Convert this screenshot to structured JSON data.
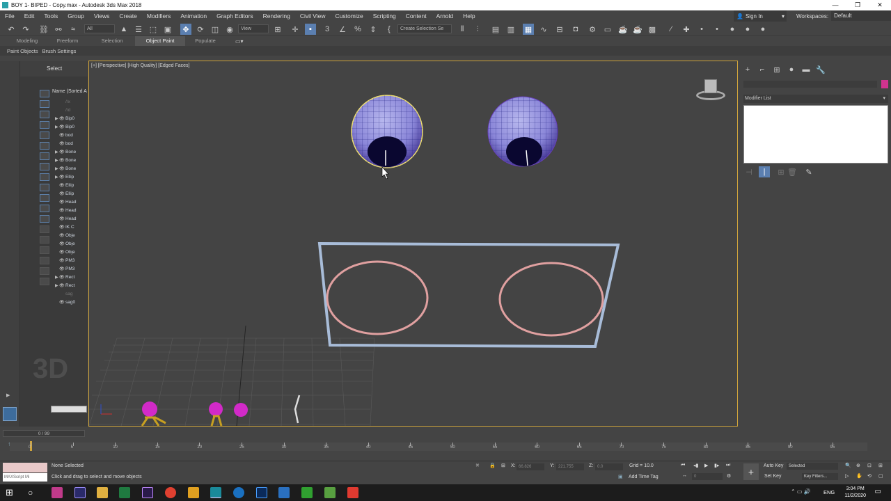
{
  "window": {
    "title": "BOY 1- BIPED - Copy.max - Autodesk 3ds Max 2018",
    "minimize": "—",
    "maximize": "❐",
    "close": "✕"
  },
  "menu": [
    "File",
    "Edit",
    "Tools",
    "Group",
    "Views",
    "Create",
    "Modifiers",
    "Animation",
    "Graph Editors",
    "Rendering",
    "Civil View",
    "Customize",
    "Scripting",
    "Content",
    "Arnold",
    "Help"
  ],
  "signin": "Sign In",
  "workspace": {
    "label": "Workspaces:",
    "value": "Default"
  },
  "toolbar": {
    "filter": "All",
    "refcoord": "View",
    "selection_set": "Create Selection Se"
  },
  "ribbon": {
    "tabs": [
      "Modeling",
      "Freeform",
      "Selection",
      "Object Paint",
      "Populate"
    ],
    "active": "Object Paint",
    "sub": [
      "Paint Objects",
      "Brush Settings"
    ]
  },
  "scene_explorer": {
    "header": "Select",
    "column": "Name (Sorted A",
    "rows": [
      "//x",
      "//d",
      "Bip0",
      "Bip0",
      "bod",
      "bod",
      "Bone",
      "Bone",
      "Bone",
      "Ellip",
      "Ellip",
      "Ellip",
      "Head",
      "Head",
      "Head",
      "IK C",
      "Obje",
      "Obje",
      "Obje",
      "PM3",
      "PM3",
      "Rect",
      "Rect",
      "sag",
      "sag0"
    ]
  },
  "viewport": {
    "label": "[+] [Perspective] [High Quality] [Edged Faces]"
  },
  "command_panel": {
    "modifier_list": "Modifier List"
  },
  "timeline": {
    "frame": "0 / 99",
    "ticks": [
      "0",
      "5",
      "10",
      "15",
      "20",
      "25",
      "30",
      "35",
      "40",
      "45",
      "50",
      "55",
      "60",
      "65",
      "70",
      "75",
      "80",
      "85",
      "90",
      "95"
    ]
  },
  "status": {
    "maxscript": "MAXScript Mi",
    "selected": "None Selected",
    "prompt": "Click and drag to select and move objects",
    "x_label": "X:",
    "x_val": "66.826",
    "y_label": "Y:",
    "y_val": "221.755",
    "z_label": "Z:",
    "z_val": "0.0",
    "grid": "Grid = 10.0",
    "add_time_tag": "Add Time Tag",
    "auto_key": "Auto Key",
    "key_mode": "Selected",
    "set_key": "Set Key",
    "key_filters": "Key Filters...",
    "frame_field": "0"
  },
  "taskbar": {
    "lang": "ENG",
    "time": "3:04 PM",
    "date": "11/2/2020"
  },
  "colors": {
    "accent": "#5b7fb0",
    "viewport_border": "#d0a53c",
    "swatch": "#d0338f"
  }
}
